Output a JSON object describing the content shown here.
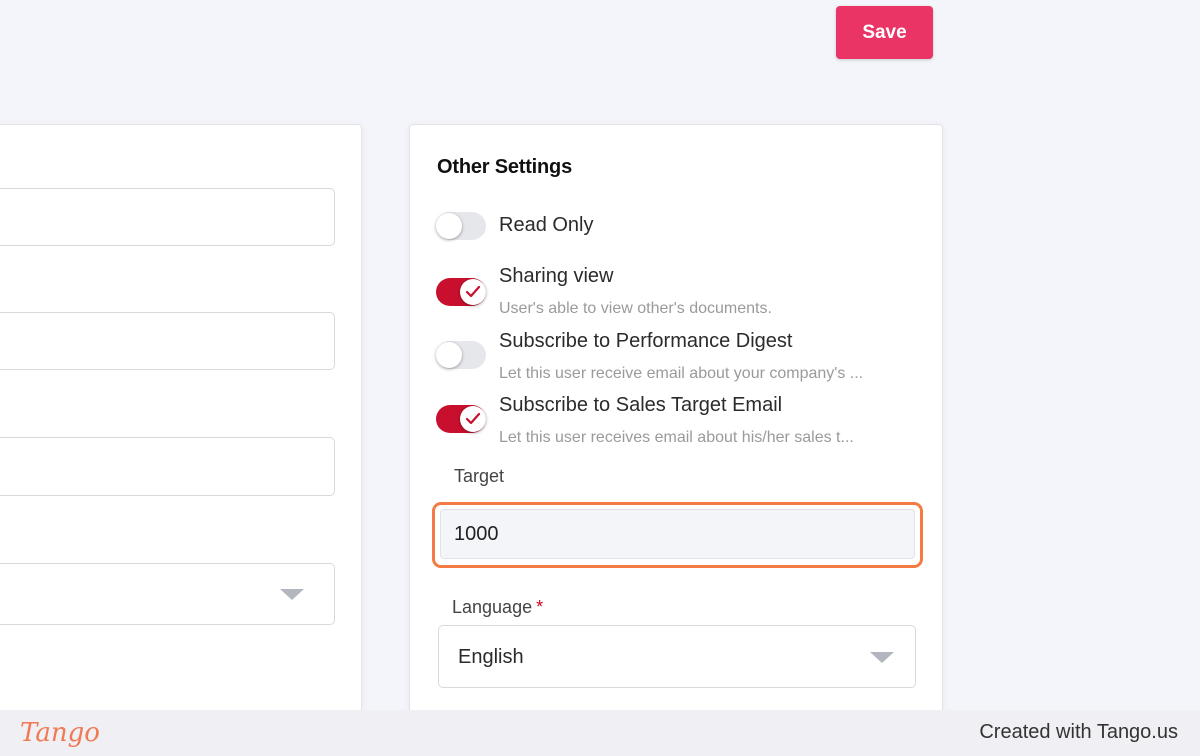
{
  "toolbar": {
    "save_label": "Save"
  },
  "other_settings": {
    "title": "Other Settings",
    "options": [
      {
        "label": "Read Only",
        "enabled": false,
        "description": ""
      },
      {
        "label": "Sharing view",
        "enabled": true,
        "description": "User's able to view other's documents."
      },
      {
        "label": "Subscribe to Performance Digest",
        "enabled": false,
        "description": "Let this user receive email about your company's ..."
      },
      {
        "label": "Subscribe to Sales Target Email",
        "enabled": true,
        "description": "Let this user receives email about his/her sales t..."
      }
    ],
    "target": {
      "label": "Target",
      "value": "1000"
    },
    "language": {
      "label": "Language",
      "required_mark": "*",
      "value": "English"
    }
  },
  "footer": {
    "logo_text": "Tango",
    "created_text": "Created with Tango.us"
  },
  "colors": {
    "accent": "#ea3465",
    "toggle_on": "#c8102e",
    "highlight": "#f47c44"
  },
  "icons": {
    "toggle_check": "check-icon",
    "dropdown": "chevron-down-icon"
  }
}
